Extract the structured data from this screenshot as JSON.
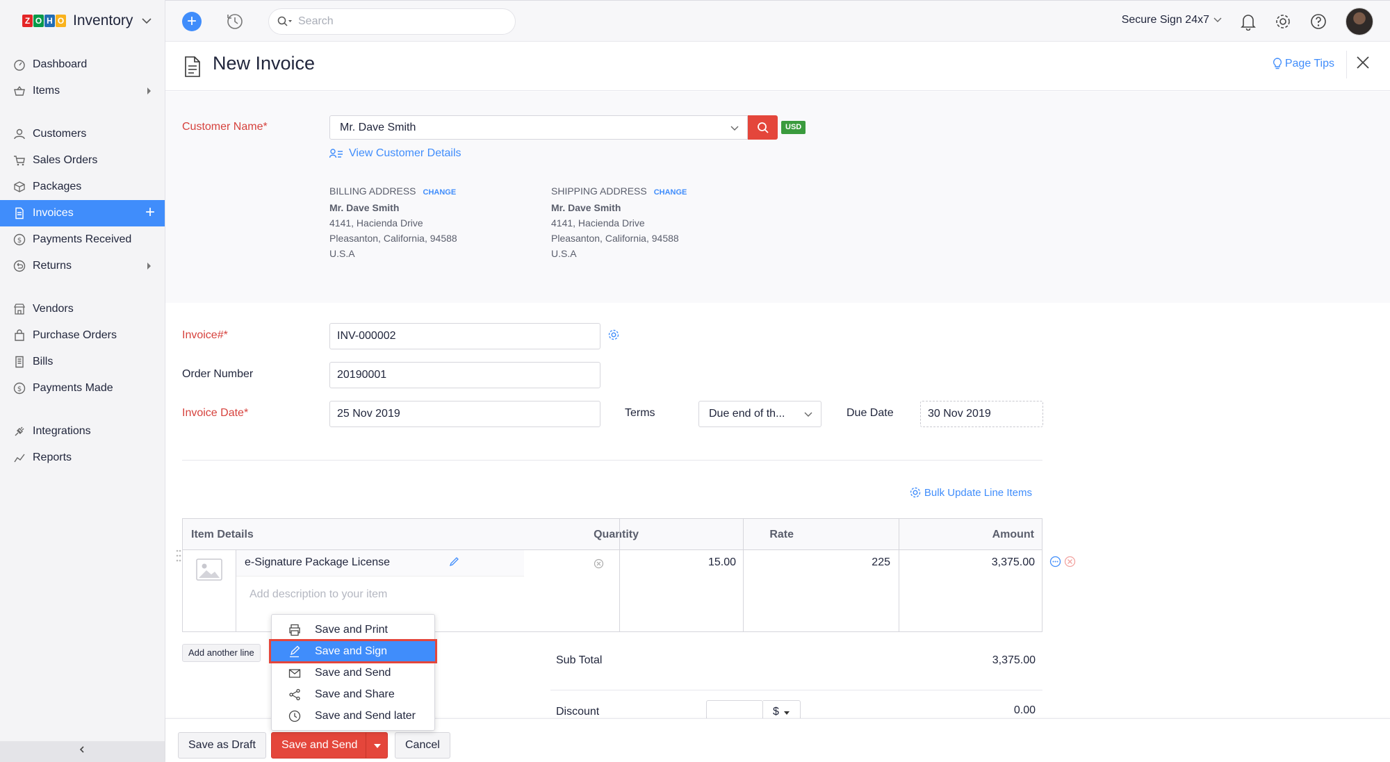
{
  "brand": {
    "logo_letters": [
      "Z",
      "O",
      "H",
      "O"
    ],
    "logo_colors": [
      "#e42527",
      "#089949",
      "#226db4",
      "#f9b21d"
    ],
    "product": "Inventory"
  },
  "sidebar": {
    "items": [
      {
        "label": "Dashboard",
        "icon": "dashboard-icon"
      },
      {
        "label": "Items",
        "icon": "basket-icon",
        "has_children": true
      },
      {
        "label": "Customers",
        "icon": "person-icon"
      },
      {
        "label": "Sales Orders",
        "icon": "cart-icon"
      },
      {
        "label": "Packages",
        "icon": "package-icon"
      },
      {
        "label": "Invoices",
        "icon": "document-icon",
        "active": true
      },
      {
        "label": "Payments Received",
        "icon": "dollar-coin-icon"
      },
      {
        "label": "Returns",
        "icon": "return-icon",
        "has_children": true
      },
      {
        "label": "Vendors",
        "icon": "store-icon"
      },
      {
        "label": "Purchase Orders",
        "icon": "bag-icon"
      },
      {
        "label": "Bills",
        "icon": "bill-icon"
      },
      {
        "label": "Payments Made",
        "icon": "dollar-coin-icon"
      },
      {
        "label": "Integrations",
        "icon": "plug-icon"
      },
      {
        "label": "Reports",
        "icon": "chart-line-icon"
      }
    ]
  },
  "topbar": {
    "search_placeholder": "Search",
    "org_name": "Secure Sign 24x7"
  },
  "header": {
    "title": "New Invoice",
    "page_tips": "Page Tips"
  },
  "customer": {
    "label": "Customer Name*",
    "value": "Mr. Dave Smith",
    "currency": "USD",
    "view_details": "View Customer Details",
    "billing": {
      "heading": "BILLING ADDRESS",
      "change": "CHANGE",
      "name": "Mr. Dave Smith",
      "line1": "4141, Hacienda Drive",
      "line2": "Pleasanton, California, 94588",
      "country": "U.S.A"
    },
    "shipping": {
      "heading": "SHIPPING ADDRESS",
      "change": "CHANGE",
      "name": "Mr. Dave Smith",
      "line1": "4141, Hacienda Drive",
      "line2": "Pleasanton, California, 94588",
      "country": "U.S.A"
    }
  },
  "invoice": {
    "number_label": "Invoice#*",
    "number_value": "INV-000002",
    "order_label": "Order Number",
    "order_value": "20190001",
    "date_label": "Invoice Date*",
    "date_value": "25 Nov 2019",
    "terms_label": "Terms",
    "terms_value": "Due end of th...",
    "due_label": "Due Date",
    "due_value": "30 Nov 2019"
  },
  "items_table": {
    "bulk_update": "Bulk Update Line Items",
    "headers": {
      "item": "Item Details",
      "quantity": "Quantity",
      "rate": "Rate",
      "amount": "Amount"
    },
    "rows": [
      {
        "name": "e-Signature Package License",
        "description_placeholder": "Add description to your item",
        "quantity": "15.00",
        "rate": "225",
        "amount": "3,375.00"
      }
    ],
    "add_line": "Add another line"
  },
  "totals": {
    "subtotal_label": "Sub Total",
    "subtotal_value": "3,375.00",
    "discount_label": "Discount",
    "discount_unit": "$",
    "discount_value": "0.00"
  },
  "footer": {
    "save_draft": "Save as Draft",
    "save_send": "Save and Send",
    "cancel": "Cancel"
  },
  "save_menu": {
    "items": [
      {
        "label": "Save and Print",
        "icon": "printer-icon"
      },
      {
        "label": "Save and Sign",
        "icon": "pen-icon",
        "highlighted": true
      },
      {
        "label": "Save and Send",
        "icon": "envelope-icon"
      },
      {
        "label": "Save and Share",
        "icon": "share-icon"
      },
      {
        "label": "Save and Send later",
        "icon": "clock-icon"
      }
    ]
  }
}
